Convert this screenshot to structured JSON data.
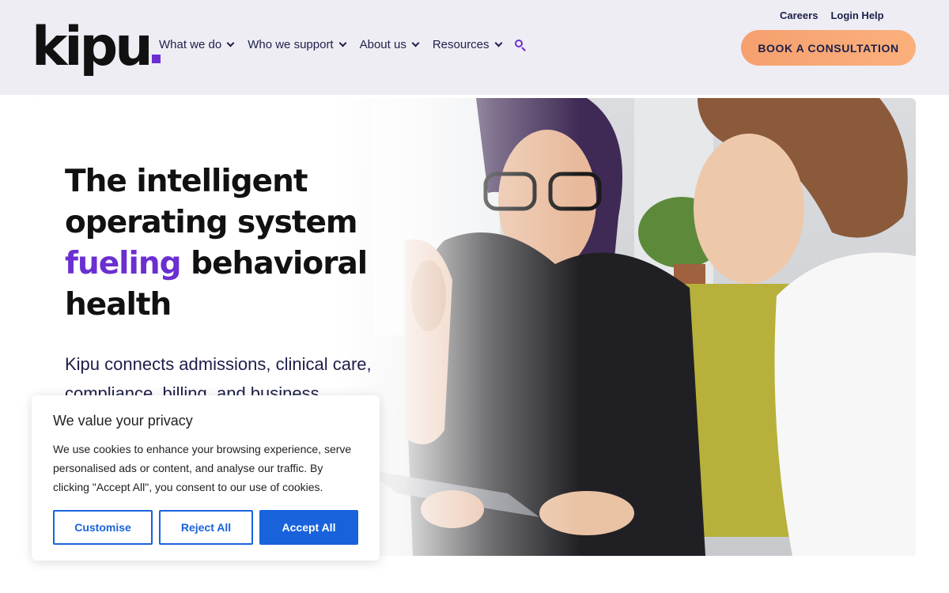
{
  "header": {
    "logo_text": "kipu",
    "nav": [
      {
        "label": "What we do"
      },
      {
        "label": "Who we support"
      },
      {
        "label": "About us"
      },
      {
        "label": "Resources"
      }
    ],
    "search_icon": "search-icon",
    "utility_links": {
      "careers": "Careers",
      "login_help": "Login Help"
    },
    "cta_label": "BOOK A CONSULTATION"
  },
  "hero": {
    "headline_line1": "The intelligent",
    "headline_line2": "operating system",
    "headline_accent": "fueling",
    "headline_line3_rest": " behavioral",
    "headline_line4": "health",
    "subtext": "Kipu connects admissions, clinical care, compliance, billing, and business"
  },
  "cookie_banner": {
    "title": "We value your privacy",
    "body": "We use cookies to enhance your browsing experience, serve personalised ads or content, and analyse our traffic. By clicking \"Accept All\", you consent to our use of cookies.",
    "customise_label": "Customise",
    "reject_label": "Reject All",
    "accept_label": "Accept All"
  },
  "colors": {
    "brand_purple": "#6b2fd1",
    "navy_text": "#1d1f4a",
    "cta_orange": "#f7a373",
    "header_bg": "#eeedf4",
    "cookie_blue": "#1863dc"
  }
}
